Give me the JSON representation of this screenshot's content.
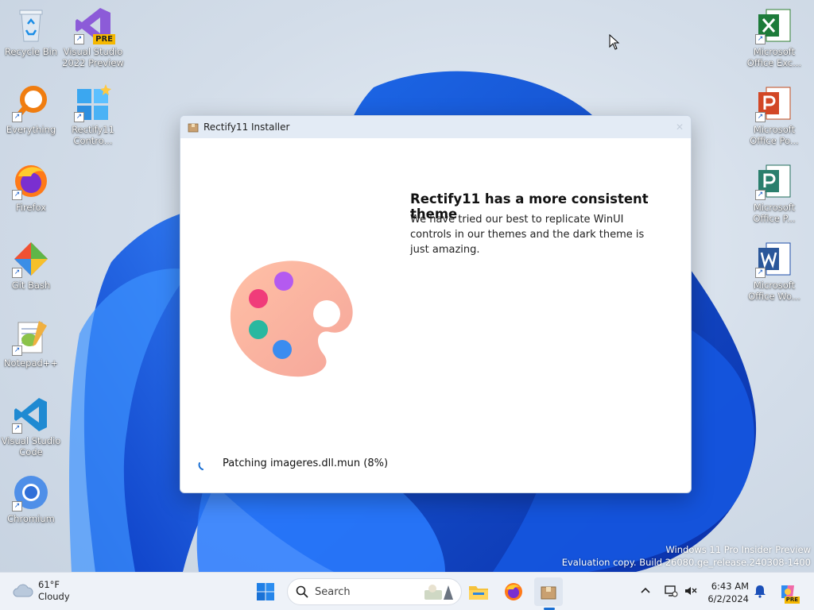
{
  "desktop": {
    "icons_left": [
      {
        "label": "Recycle Bin"
      },
      {
        "label": "Everything"
      },
      {
        "label": "Firefox"
      },
      {
        "label": "Git Bash"
      },
      {
        "label": "Notepad++"
      },
      {
        "label": "Visual Studio Code"
      },
      {
        "label": "Chromium"
      }
    ],
    "icons_col2": [
      {
        "label": "Visual Studio 2022 Preview",
        "badge": "PRE"
      },
      {
        "label": "Rectify11 Contro..."
      }
    ],
    "icons_right": [
      {
        "label": "Microsoft Office Exc..."
      },
      {
        "label": "Microsoft Office Po..."
      },
      {
        "label": "Microsoft Office P..."
      },
      {
        "label": "Microsoft Office Wo..."
      }
    ],
    "watermark": {
      "line1": "Windows 11 Pro Insider Preview",
      "line2": "Evaluation copy. Build 26080.ge_release.240308-1400"
    }
  },
  "window": {
    "title": "Rectify11 Installer",
    "close_glyph": "✕",
    "headline": "Rectify11 has a more consistent theme",
    "description": "We have tried our best to replicate WinUI controls in our themes and the dark theme is just amazing.",
    "status": "Patching imageres.dll.mun (8%)",
    "progress_percent": 8
  },
  "taskbar": {
    "weather": {
      "temp": "61°F",
      "condition": "Cloudy"
    },
    "search": {
      "label": "Search"
    },
    "pinned": [
      "start-icon",
      "file-explorer-icon",
      "firefox-icon",
      "rectify11-installer-icon"
    ],
    "clock": {
      "time": "6:43 AM",
      "date": "6/2/2024"
    },
    "copilot_badge": "PRE"
  },
  "colors": {
    "accent": "#1a6fd3",
    "titlebar": "#e3ebf5",
    "taskbar": "#eef2f8"
  }
}
